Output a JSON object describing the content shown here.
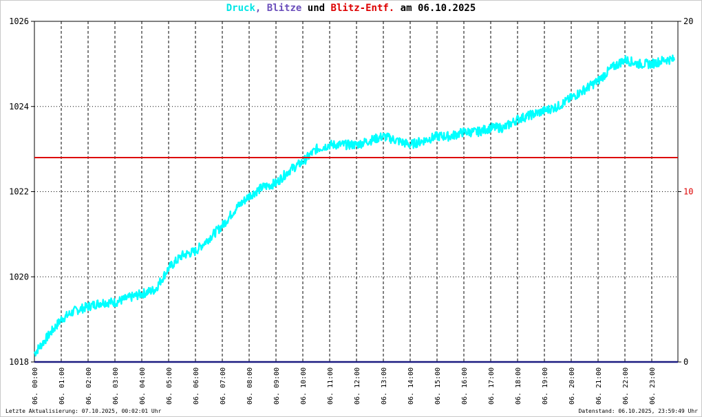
{
  "title_parts": {
    "druck": "Druck",
    "comma": ",",
    "blitze": "Blitze",
    "und": "und",
    "blitz_entf": "Blitz-Entf.",
    "am": "am 06.10.2025"
  },
  "colors": {
    "druck": "#00ffff",
    "blitze": "#6b4fbb",
    "blitz_entf": "#dd0000",
    "baseline": "#1a1a80",
    "title_text": "#000000"
  },
  "footer": {
    "left": "Letzte Aktualisierung: 07.10.2025, 00:02:01 Uhr",
    "right": "Datenstand: 06.10.2025, 23:59:49 Uhr"
  },
  "chart_data": {
    "type": "line",
    "title": "Druck, Blitze und Blitz-Entf. am 06.10.2025",
    "x_tick_labels": [
      "06. 00:00",
      "06. 01:00",
      "06. 02:00",
      "06. 03:00",
      "06. 04:00",
      "06. 05:00",
      "06. 06:00",
      "06. 07:00",
      "06. 08:00",
      "06. 09:00",
      "06. 10:00",
      "06. 11:00",
      "06. 12:00",
      "06. 13:00",
      "06. 14:00",
      "06. 15:00",
      "06. 16:00",
      "06. 17:00",
      "06. 18:00",
      "06. 19:00",
      "06. 20:00",
      "06. 21:00",
      "06. 22:00",
      "06. 23:00"
    ],
    "xlim_hours": [
      0,
      24
    ],
    "y_left": {
      "min": 1018,
      "max": 1026,
      "ticks": [
        1018,
        1020,
        1022,
        1024,
        1026
      ]
    },
    "y_right": {
      "min": 0,
      "max": 20,
      "ticks": [
        0,
        10,
        20
      ]
    },
    "grid": true,
    "series": [
      {
        "name": "Druck",
        "axis": "left",
        "x_hours": [
          0,
          0.5,
          1,
          1.5,
          2,
          2.5,
          3,
          3.5,
          4,
          4.5,
          5,
          5.5,
          6,
          6.5,
          7,
          7.5,
          8,
          8.5,
          9,
          9.5,
          10,
          10.5,
          11,
          11.5,
          12,
          12.5,
          13,
          13.5,
          14,
          14.5,
          15,
          15.5,
          16,
          16.5,
          17,
          17.5,
          18,
          18.5,
          19,
          19.5,
          20,
          20.5,
          21,
          21.5,
          22,
          22.5,
          23,
          23.5,
          24
        ],
        "y": [
          1018.2,
          1018.6,
          1019.0,
          1019.2,
          1019.3,
          1019.4,
          1019.4,
          1019.5,
          1019.6,
          1019.7,
          1020.2,
          1020.5,
          1020.6,
          1020.9,
          1021.2,
          1021.6,
          1021.9,
          1022.1,
          1022.2,
          1022.5,
          1022.7,
          1023.0,
          1023.1,
          1023.1,
          1023.1,
          1023.2,
          1023.3,
          1023.2,
          1023.1,
          1023.2,
          1023.3,
          1023.3,
          1023.4,
          1023.4,
          1023.5,
          1023.5,
          1023.7,
          1023.8,
          1023.9,
          1024.0,
          1024.2,
          1024.4,
          1024.6,
          1024.9,
          1025.1,
          1025.0,
          1025.0,
          1025.1,
          1025.1
        ]
      },
      {
        "name": "Blitze",
        "axis": "right",
        "y_const": 0
      },
      {
        "name": "Blitz-Entf.",
        "axis": "right",
        "y_const": 12
      }
    ]
  }
}
